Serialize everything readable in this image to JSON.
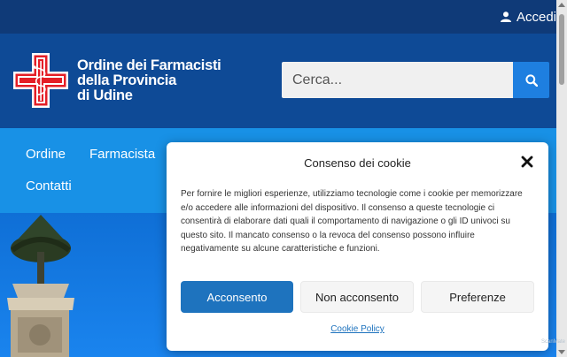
{
  "topbar": {
    "login_label": "Accedi"
  },
  "brand": {
    "line1": "Ordine dei Farmacisti",
    "line2": "della Provincia",
    "line3": "di Udine"
  },
  "search": {
    "placeholder": "Cerca..."
  },
  "nav": {
    "items": [
      "Ordine",
      "Farmacista",
      "Contatti"
    ]
  },
  "cookie": {
    "title": "Consenso dei cookie",
    "text": "Per fornire le migliori esperienze, utilizziamo tecnologie come i cookie per memorizzare e/o accedere alle informazioni del dispositivo. Il consenso a queste tecnologie ci consentirà di elaborare dati quali il comportamento di navigazione o gli ID univoci su questo sito. Il mancato consenso o la revoca del consenso possono influire negativamente su alcune caratteristiche e funzioni.",
    "accept_label": "Acconsento",
    "deny_label": "Non acconsento",
    "prefs_label": "Preferenze",
    "policy_label": "Cookie Policy"
  },
  "watermark": "ScanMate",
  "colors": {
    "topbar": "#0f3a78",
    "header": "#0e4a96",
    "nav": "#1891e6",
    "accent": "#1e73be",
    "logo_red": "#e41e26"
  },
  "icons": {
    "user": "user-icon",
    "search": "search-icon",
    "close": "close-icon",
    "logo": "pharmacy-cross-logo"
  }
}
